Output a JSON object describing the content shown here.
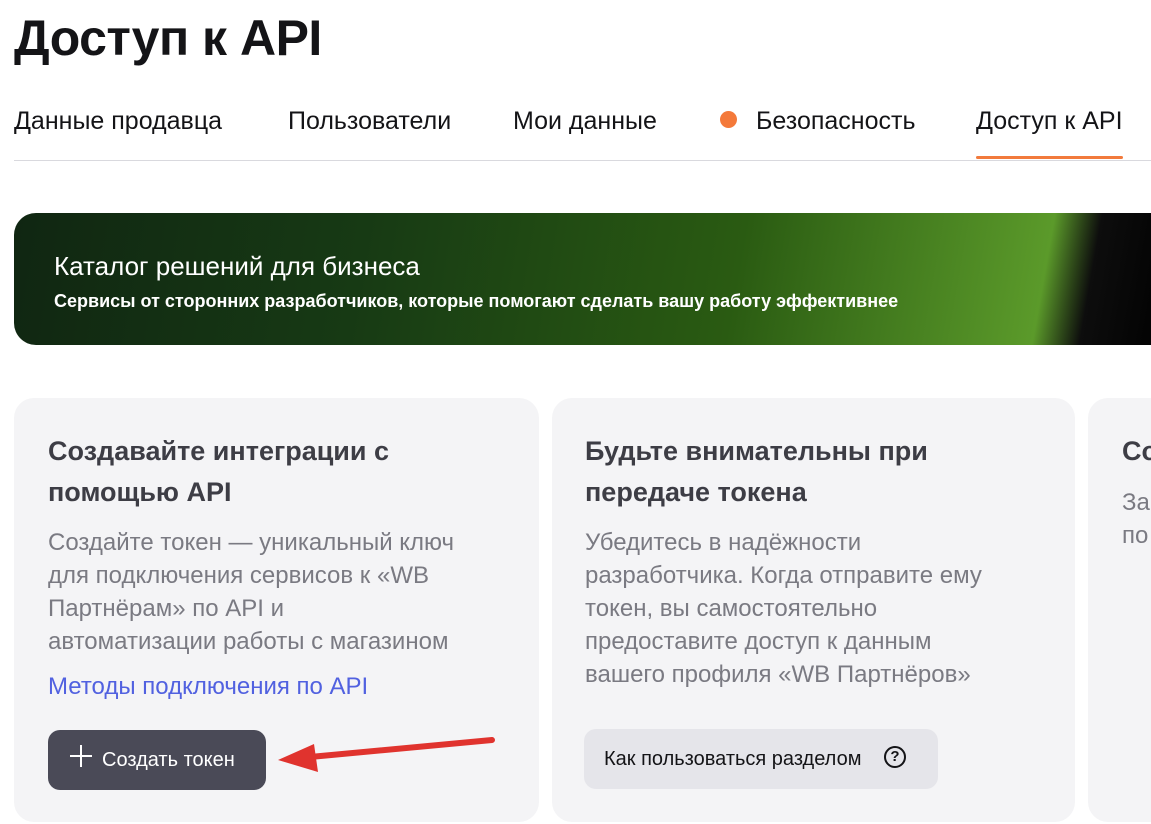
{
  "page": {
    "title": "Доступ к API"
  },
  "tabs": [
    {
      "label": "Данные продавца"
    },
    {
      "label": "Пользователи"
    },
    {
      "label": "Мои данные"
    },
    {
      "label": "Безопасность",
      "has_dot": true
    },
    {
      "label": "Доступ к API",
      "active": true
    }
  ],
  "banner": {
    "title": "Каталог решений для бизнеса",
    "subtitle": "Сервисы от сторонних разработчиков, которые помогают сделать вашу работу эффективнее"
  },
  "cards": [
    {
      "title_lines": [
        "Создавайте интеграции с",
        "помощью API"
      ],
      "body_lines": [
        "Создайте токен — уникальный ключ",
        "для подключения сервисов к «WB",
        "Партнёрам» по API и",
        "автоматизации работы с магазином"
      ],
      "link": "Методы подключения по API",
      "button": "Создать токен"
    },
    {
      "title_lines": [
        "Будьте внимательны при",
        "передаче токена"
      ],
      "body_lines": [
        "Убедитесь в надёжности",
        "разработчика. Когда отправите ему",
        "токен, вы самостоятельно",
        "предоставите доступ к данным",
        "вашего профиля «WB Партнёров»"
      ],
      "button": "Как пользоваться разделом",
      "help_icon": "?"
    },
    {
      "title_lines": [
        "Со"
      ],
      "body_lines": [
        "За",
        "по"
      ]
    }
  ],
  "colors": {
    "accent": "#f27a3c",
    "link": "#5161e0",
    "button_dark": "#4a4a57",
    "annotation_arrow": "#e0332e"
  }
}
